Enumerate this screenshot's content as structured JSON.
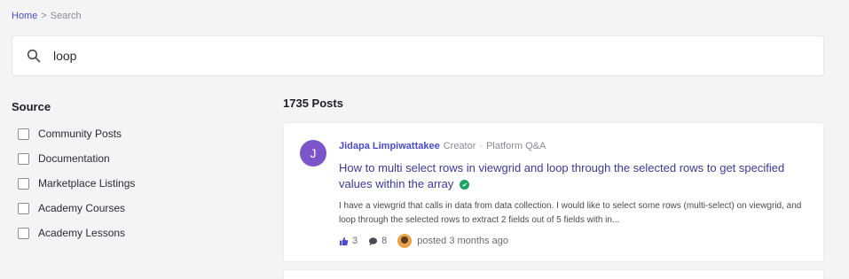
{
  "breadcrumb": {
    "home": "Home",
    "separator": ">",
    "current": "Search"
  },
  "search": {
    "value": "loop",
    "icon": "search-icon"
  },
  "sidebar": {
    "title": "Source",
    "filters": [
      {
        "label": "Community Posts",
        "checked": false
      },
      {
        "label": "Documentation",
        "checked": false
      },
      {
        "label": "Marketplace Listings",
        "checked": false
      },
      {
        "label": "Academy Courses",
        "checked": false
      },
      {
        "label": "Academy Lessons",
        "checked": false
      }
    ]
  },
  "results": {
    "count_label": "1735 Posts",
    "posts": [
      {
        "avatar_initial": "J",
        "avatar_color": "#7b55c9",
        "author": "Jidapa Limpiwattakee",
        "role": "Creator",
        "separator": "·",
        "category": "Platform Q&A",
        "title": "How to multi select rows in viewgrid and loop through the selected rows to get specified values within the array",
        "solved": true,
        "excerpt": "I have a viewgrid that calls in data from data collection. I would like to select some rows (multi-select) on viewgrid, and loop through the selected rows to extract 2 fields out of 5 fields with in...",
        "likes": "3",
        "comments": "8",
        "posted": "posted 3 months ago"
      }
    ]
  },
  "colors": {
    "accent": "#4a4ad0",
    "solved": "#1aa260",
    "background": "#f4f4f6"
  }
}
